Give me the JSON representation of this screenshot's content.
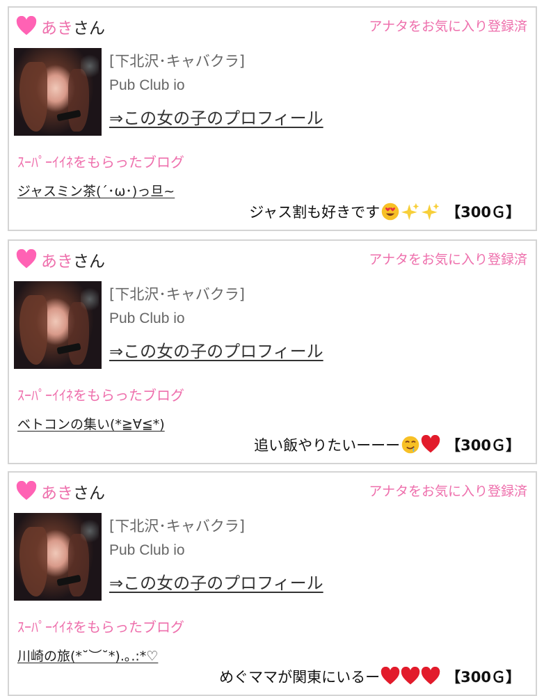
{
  "cards": [
    {
      "name": "あき",
      "honorific": "さん",
      "favorite_label": "アナタをお気に入り登録済",
      "area": "[下北沢･キャバクラ]",
      "club": "Pub Club io",
      "profile_link": "⇒この女の子のプロフィール",
      "blog_label": "ｽｰﾊﾟｰｲｲﾈをもらったブログ",
      "blog_title": "ジャスミン茶(´･ω･)っ旦~",
      "comment": "ジャス割も好きです",
      "emoji_icons": [
        "heart-eyes-icon",
        "sparkles-icon",
        "sparkles-icon"
      ],
      "price": "【300Ｇ】"
    },
    {
      "name": "あき",
      "honorific": "さん",
      "favorite_label": "アナタをお気に入り登録済",
      "area": "[下北沢･キャバクラ]",
      "club": "Pub Club io",
      "profile_link": "⇒この女の子のプロフィール",
      "blog_label": "ｽｰﾊﾟｰｲｲﾈをもらったブログ",
      "blog_title": "ベトコンの集い(*≧∀≦*)",
      "comment": "追い飯やりたいーーー",
      "emoji_icons": [
        "drooling-face-icon",
        "red-heart-icon"
      ],
      "price": "【300Ｇ】"
    },
    {
      "name": "あき",
      "honorific": "さん",
      "favorite_label": "アナタをお気に入り登録済",
      "area": "[下北沢･キャバクラ]",
      "club": "Pub Club io",
      "profile_link": "⇒この女の子のプロフィール",
      "blog_label": "ｽｰﾊﾟｰｲｲﾈをもらったブログ",
      "blog_title": "川崎の旅(*˘︶˘*).｡.:*♡",
      "comment": "めぐママが関東にいるー",
      "emoji_icons": [
        "red-heart-icon",
        "red-heart-icon",
        "red-heart-icon"
      ],
      "price": "【300Ｇ】"
    }
  ],
  "colors": {
    "accent_pink": "#ee6fac",
    "border": "#d4d4d4",
    "text": "#222222"
  }
}
